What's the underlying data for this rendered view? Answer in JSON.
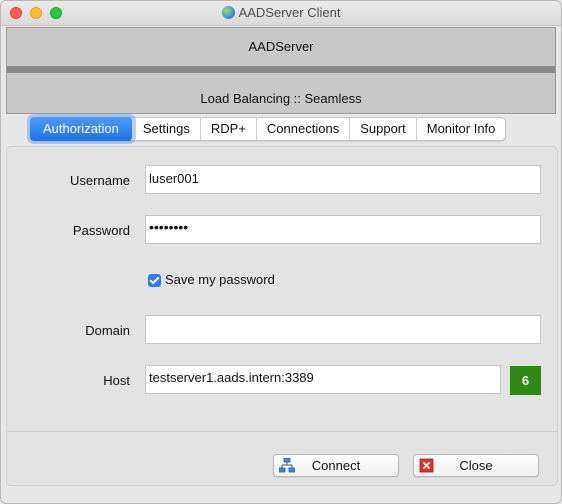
{
  "window": {
    "title": "AADServer Client"
  },
  "banner": {
    "title": "AADServer",
    "subtitle": "Load Balancing :: Seamless"
  },
  "tabs": [
    {
      "label": "Authorization",
      "active": true
    },
    {
      "label": "Settings"
    },
    {
      "label": "RDP+"
    },
    {
      "label": "Connections"
    },
    {
      "label": "Support"
    },
    {
      "label": "Monitor Info"
    }
  ],
  "form": {
    "username_label": "Username",
    "username_value": "luser001",
    "password_label": "Password",
    "password_value": "••••••••",
    "save_password_label": "Save my password",
    "save_password_checked": true,
    "domain_label": "Domain",
    "domain_value": "",
    "host_label": "Host",
    "host_value": "testserver1.aads.intern:3389",
    "host_count": "6",
    "host_count_color": "#2e8a15"
  },
  "buttons": {
    "connect_label": "Connect",
    "connect_icon": "network-icon",
    "close_label": "Close",
    "close_icon": "close-icon"
  }
}
